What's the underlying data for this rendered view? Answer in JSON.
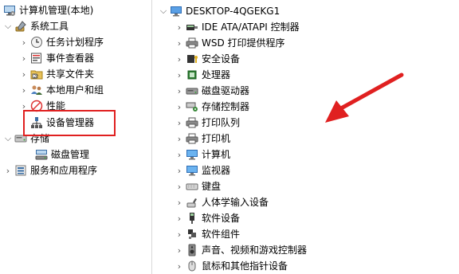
{
  "left_tree": {
    "root": {
      "label": "计算机管理(本地)",
      "icon": "computer-management-icon"
    },
    "system_tools": {
      "label": "系统工具",
      "icon": "system-tools-icon",
      "expander": "expanded"
    },
    "task_scheduler": {
      "label": "任务计划程序",
      "icon": "clock-icon"
    },
    "event_viewer": {
      "label": "事件查看器",
      "icon": "event-viewer-icon"
    },
    "shared_folders": {
      "label": "共享文件夹",
      "icon": "shared-folder-icon"
    },
    "local_users": {
      "label": "本地用户和组",
      "icon": "users-icon"
    },
    "performance": {
      "label": "性能",
      "icon": "performance-icon"
    },
    "device_manager": {
      "label": "设备管理器",
      "icon": "device-manager-icon"
    },
    "storage": {
      "label": "存储",
      "icon": "storage-icon",
      "expander": "expanded"
    },
    "disk_management": {
      "label": "磁盘管理",
      "icon": "disk-management-icon"
    },
    "services_apps": {
      "label": "服务和应用程序",
      "icon": "services-icon"
    }
  },
  "right_tree": {
    "computer": {
      "label": "DESKTOP-4QGEKG1",
      "icon": "desktop-computer-icon"
    },
    "devices": [
      {
        "label": "IDE ATA/ATAPI 控制器",
        "icon": "ide-controller-icon"
      },
      {
        "label": "WSD 打印提供程序",
        "icon": "printer-icon"
      },
      {
        "label": "安全设备",
        "icon": "security-key-icon"
      },
      {
        "label": "处理器",
        "icon": "processor-icon"
      },
      {
        "label": "磁盘驱动器",
        "icon": "disk-drive-icon"
      },
      {
        "label": "存储控制器",
        "icon": "storage-controller-icon"
      },
      {
        "label": "打印队列",
        "icon": "printer-icon"
      },
      {
        "label": "打印机",
        "icon": "printer-icon"
      },
      {
        "label": "计算机",
        "icon": "monitor-icon"
      },
      {
        "label": "监视器",
        "icon": "monitor-icon"
      },
      {
        "label": "键盘",
        "icon": "keyboard-icon"
      },
      {
        "label": "人体学输入设备",
        "icon": "hid-icon"
      },
      {
        "label": "软件设备",
        "icon": "software-device-icon"
      },
      {
        "label": "软件组件",
        "icon": "software-component-icon"
      },
      {
        "label": "声音、视频和游戏控制器",
        "icon": "speaker-icon"
      },
      {
        "label": "鼠标和其他指针设备",
        "icon": "mouse-icon"
      }
    ]
  },
  "annotation": {
    "highlight_color": "#e02020",
    "arrow_color": "#e02020"
  }
}
